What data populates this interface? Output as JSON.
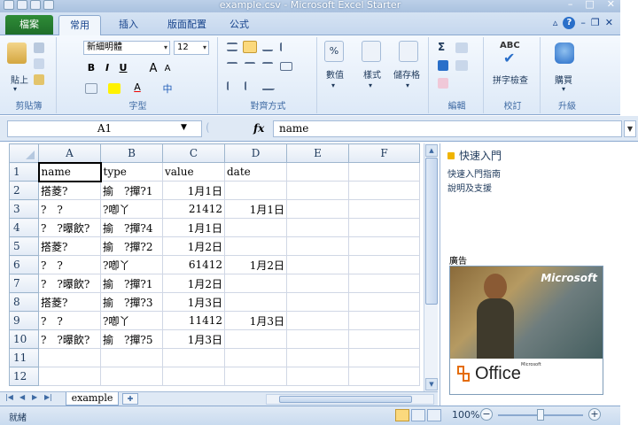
{
  "window": {
    "title": "example.csv - Microsoft Excel Starter"
  },
  "tabs": {
    "file": "檔案",
    "home": "常用",
    "insert": "插入",
    "page_layout": "版面配置",
    "formulas": "公式"
  },
  "ribbon": {
    "clipboard": {
      "paste": "貼上",
      "label": "剪貼簿"
    },
    "font": {
      "name": "新細明體",
      "size": "12",
      "label": "字型",
      "bold": "B",
      "italic": "I",
      "underline": "U",
      "grow": "A",
      "shrink": "A",
      "color": "A",
      "phonetic": "中"
    },
    "alignment": {
      "label": "對齊方式"
    },
    "number": {
      "button": "數值",
      "percent": "%"
    },
    "styles": {
      "button": "樣式"
    },
    "cells": {
      "button": "儲存格"
    },
    "editing": {
      "label": "編輯",
      "sum": "Σ"
    },
    "proofing": {
      "button": "拼字檢查",
      "label": "校訂",
      "abc": "ABC"
    },
    "upgrade": {
      "button": "購買",
      "label": "升級"
    }
  },
  "formula_bar": {
    "name_box": "A1",
    "fx": "fx",
    "content": "name"
  },
  "grid": {
    "columns": [
      "A",
      "B",
      "C",
      "D",
      "E",
      "F"
    ],
    "rows": [
      {
        "n": "1",
        "cells": [
          "name",
          "type",
          "value",
          "date",
          "",
          ""
        ]
      },
      {
        "n": "2",
        "cells": [
          "搭菱?",
          "揄　?撣?1",
          "1月1日",
          "",
          "",
          ""
        ]
      },
      {
        "n": "3",
        "cells": [
          "?　?",
          "?喞丫",
          "21412",
          "1月1日",
          "",
          ""
        ]
      },
      {
        "n": "4",
        "cells": [
          "?　?曝飲?",
          "揄　?撣?4",
          "1月1日",
          "",
          "",
          ""
        ]
      },
      {
        "n": "5",
        "cells": [
          "搭菱?",
          "揄　?撣?2",
          "1月2日",
          "",
          "",
          ""
        ]
      },
      {
        "n": "6",
        "cells": [
          "?　?",
          "?喞丫",
          "61412",
          "1月2日",
          "",
          ""
        ]
      },
      {
        "n": "7",
        "cells": [
          "?　?曝飲?",
          "揄　?撣?1",
          "1月2日",
          "",
          "",
          ""
        ]
      },
      {
        "n": "8",
        "cells": [
          "搭菱?",
          "揄　?撣?3",
          "1月3日",
          "",
          "",
          ""
        ]
      },
      {
        "n": "9",
        "cells": [
          "?　?",
          "?喞丫",
          "11412",
          "1月3日",
          "",
          ""
        ]
      },
      {
        "n": "10",
        "cells": [
          "?　?曝飲?",
          "揄　?撣?5",
          "1月3日",
          "",
          "",
          ""
        ]
      },
      {
        "n": "11",
        "cells": [
          "",
          "",
          "",
          "",
          "",
          ""
        ]
      },
      {
        "n": "12",
        "cells": [
          "",
          "",
          "",
          "",
          "",
          ""
        ]
      }
    ]
  },
  "sheet_tabs": {
    "active": "example"
  },
  "task_pane": {
    "title": "快速入門",
    "links": [
      "快速入門指南",
      "說明及支援"
    ],
    "ad_label": "廣告",
    "ad_brand": "Microsoft",
    "ad_product": "Office",
    "ad_small": "Microsoft"
  },
  "status": {
    "ready": "就緒",
    "zoom": "100%",
    "zoom_minus": "−",
    "zoom_plus": "+"
  }
}
